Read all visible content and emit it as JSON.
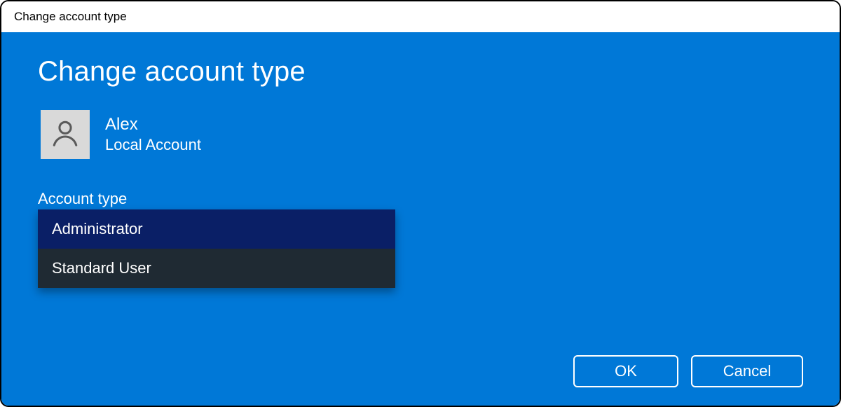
{
  "titlebar": {
    "title": "Change account type"
  },
  "heading": "Change account type",
  "account": {
    "name": "Alex",
    "subtitle": "Local Account"
  },
  "field": {
    "label": "Account type",
    "options": [
      "Administrator",
      "Standard User"
    ],
    "selected_index": 0
  },
  "buttons": {
    "ok": "OK",
    "cancel": "Cancel"
  },
  "colors": {
    "brand": "#0078d7",
    "dropdown_bg": "#1f2a33",
    "dropdown_selected": "#0a1f66",
    "avatar_bg": "#d9d9d9"
  }
}
